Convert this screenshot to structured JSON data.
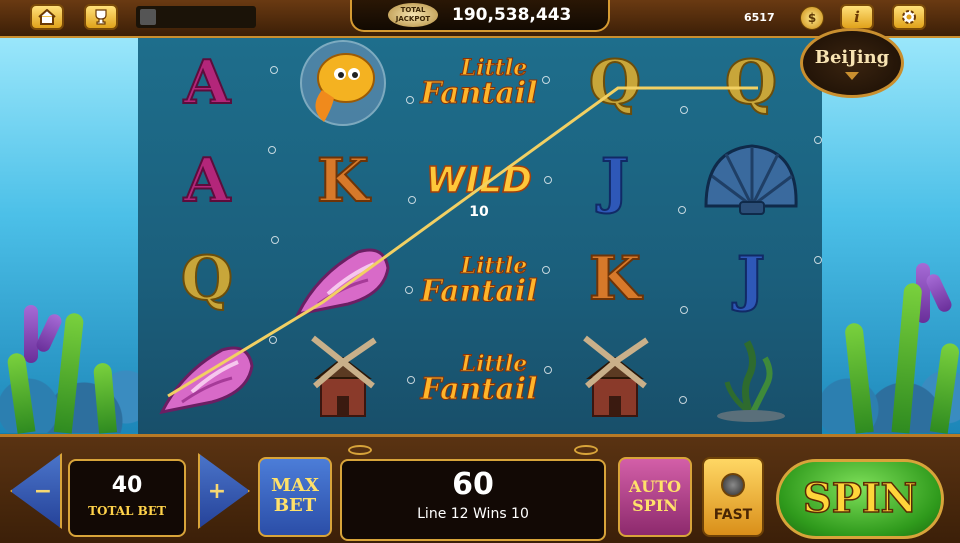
{
  "topbar": {
    "home_icon": "home-icon",
    "trophy_icon": "trophy-icon",
    "player_name": "",
    "jackpot_badge": "TOTAL JACKPOT",
    "jackpot_value": "190,538,443",
    "credits": "6517",
    "coin_icon": "$",
    "info_label": "i",
    "settings_icon": "gear-icon"
  },
  "game": {
    "location_button": "BeiJing",
    "reels": [
      [
        "A",
        "A",
        "Q",
        "conch"
      ],
      [
        "goldfish",
        "K",
        "conch",
        "windmill"
      ],
      [
        "logo",
        "wild",
        "logo",
        "logo"
      ],
      [
        "Q",
        "J",
        "K",
        "windmill"
      ],
      [
        "Q",
        "shell",
        "J",
        "seaweed"
      ]
    ],
    "logo_line1": "Little",
    "logo_line2": "Fantail",
    "wild_label": "WILD",
    "wild_multiplier": "10"
  },
  "controls": {
    "minus_label": "−",
    "plus_label": "+",
    "total_bet_value": "40",
    "total_bet_label": "TOTAL BET",
    "max_bet_label": "MAX\nBET",
    "win_value": "60",
    "win_line": "Line 12 Wins 10",
    "auto_spin_label": "AUTO\nSPIN",
    "fast_label": "FAST",
    "spin_label": "SPIN"
  },
  "colors": {
    "accent_gold": "#d8a43a",
    "spin_green": "#2f9a1c",
    "payline": "#f2d063"
  }
}
